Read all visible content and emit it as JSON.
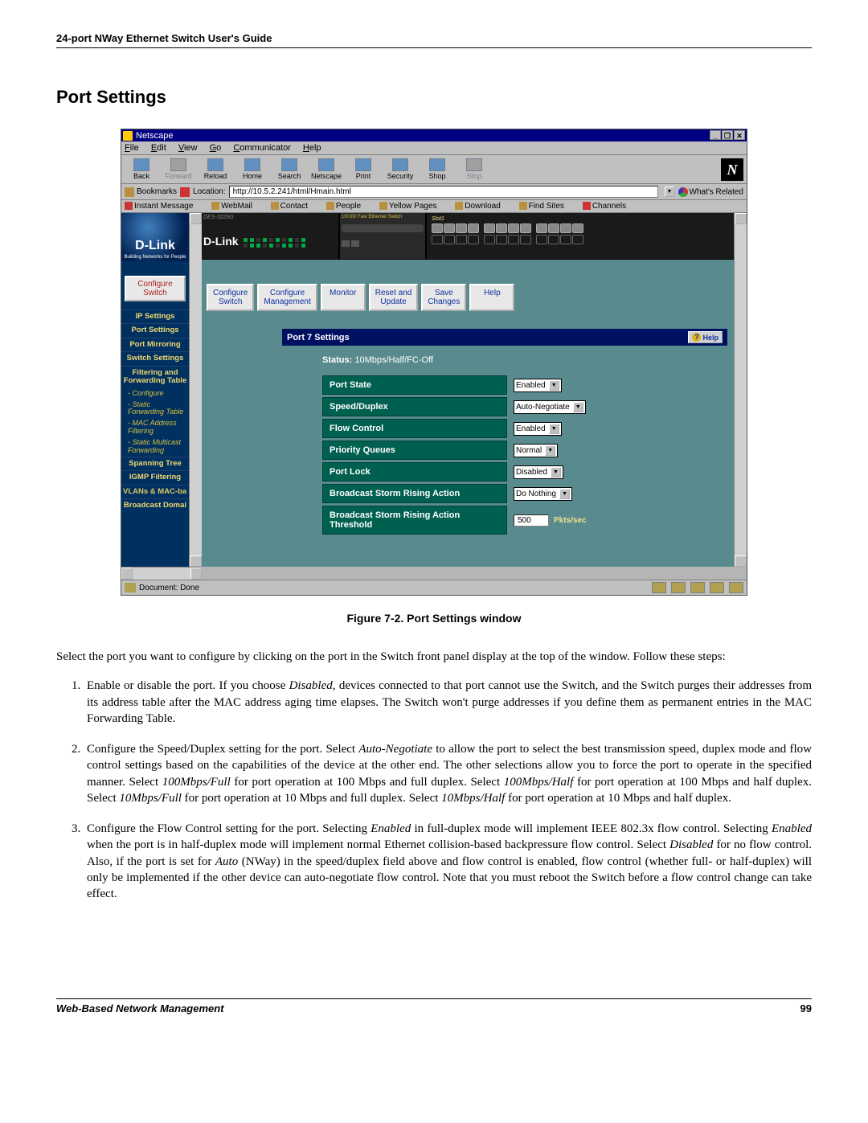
{
  "header": "24-port NWay Ethernet Switch User's Guide",
  "section_title": "Port Settings",
  "netscape": {
    "title": "Netscape",
    "menus": [
      "File",
      "Edit",
      "View",
      "Go",
      "Communicator",
      "Help"
    ],
    "toolbar": {
      "back": "Back",
      "forward": "Forward",
      "reload": "Reload",
      "home": "Home",
      "search": "Search",
      "netscape": "Netscape",
      "print": "Print",
      "security": "Security",
      "shop": "Shop",
      "stop": "Stop"
    },
    "bookmarks": "Bookmarks",
    "location_label": "Location:",
    "url": "http://10.5.2.241/html/Hmain.html",
    "whats_related": "What's Related",
    "personal": {
      "instant": "Instant Message",
      "webmail": "WebMail",
      "contact": "Contact",
      "people": "People",
      "yellow": "Yellow Pages",
      "download": "Download",
      "findsites": "Find Sites",
      "channels": "Channels"
    },
    "status": "Document: Done"
  },
  "dlink_logo": "D-Link",
  "dlink_tag": "Building Networks for People",
  "device_model": "DES-3225G",
  "device_header": "10/100 Fast Ethernet Switch",
  "sidebar": {
    "configure_switch": "Configure Switch",
    "items": {
      "ip": "IP Settings",
      "port": "Port Settings",
      "mirror": "Port Mirroring",
      "switch": "Switch Settings",
      "filter": "Filtering and Forwarding Table",
      "configure": "Configure",
      "static_fwd": "Static Forwarding Table",
      "mac_filter": "MAC Address Filtering",
      "static_mc": "Static Multicast Forwarding",
      "spanning": "Spanning Tree",
      "igmp": "IGMP Filtering",
      "vlan": "VLANs & MAC-ba",
      "broadcast": "Broadcast Domai"
    }
  },
  "nav": {
    "configure_switch": "Configure Switch",
    "configure_mgmt": "Configure Management",
    "monitor": "Monitor",
    "reset": "Reset and Update",
    "save": "Save Changes",
    "help": "Help"
  },
  "panel": {
    "title": "Port 7 Settings",
    "help_btn": "Help",
    "status_label": "Status:",
    "status_value": "10Mbps/Half/FC-Off",
    "rows": {
      "port_state": {
        "label": "Port State",
        "value": "Enabled"
      },
      "speed_duplex": {
        "label": "Speed/Duplex",
        "value": "Auto-Negotiate"
      },
      "flow_control": {
        "label": "Flow Control",
        "value": "Enabled"
      },
      "priority": {
        "label": "Priority Queues",
        "value": "Normal"
      },
      "port_lock": {
        "label": "Port Lock",
        "value": "Disabled"
      },
      "storm_action": {
        "label": "Broadcast Storm Rising Action",
        "value": "Do Nothing"
      },
      "storm_threshold": {
        "label": "Broadcast Storm Rising Action Threshold",
        "value": "500",
        "unit": "Pkts/sec"
      }
    }
  },
  "figure_caption": "Figure 7-2.  Port Settings window",
  "text": {
    "intro": "Select the port you want to configure by clicking on the port in the Switch front panel display at the top of the window. Follow these steps:",
    "step1_a": "Enable or disable the port. If you choose ",
    "step1_disabled": "Disabled",
    "step1_b": ", devices connected to that port cannot use the Switch, and the Switch purges their addresses from its address table after the MAC address aging time elapses. The Switch won't purge addresses if you define them as permanent entries in the MAC Forwarding Table.",
    "step2_a": "Configure the Speed/Duplex setting for the port. Select ",
    "step2_auto": "Auto-Negotiate",
    "step2_b": " to allow the port to select the best transmission speed, duplex mode and flow control settings based on the capabilities of the device at the other end. The other selections allow you to force the port to operate in the specified manner. Select ",
    "step2_100f": "100Mbps/Full",
    "step2_c": " for port operation at 100 Mbps and full duplex. Select ",
    "step2_100h": "100Mbps/Half",
    "step2_d": " for port operation at 100 Mbps and half duplex. Select ",
    "step2_10f": "10Mbps/Full",
    "step2_e": " for port operation at 10 Mbps and full duplex. Select ",
    "step2_10h": "10Mbps/Half",
    "step2_f": " for port operation at 10 Mbps and half duplex.",
    "step3_a": "Configure the Flow Control setting for the port. Selecting ",
    "step3_en1": "Enabled",
    "step3_b": " in full-duplex mode will implement IEEE 802.3x flow control. Selecting ",
    "step3_en2": "Enabled",
    "step3_c": " when the port is in half-duplex mode will implement normal Ethernet collision-based backpressure flow control. Select ",
    "step3_dis": "Disabled",
    "step3_d": " for no flow control. Also, if the port is set for ",
    "step3_auto": "Auto",
    "step3_e": " (NWay) in the speed/duplex field above and flow control is enabled, flow control (whether full- or half-duplex) will only be implemented if the other device can auto-negotiate flow control. Note that you must reboot the Switch before a flow control change can take effect."
  },
  "footer": {
    "left": "Web-Based Network Management",
    "page": "99"
  }
}
